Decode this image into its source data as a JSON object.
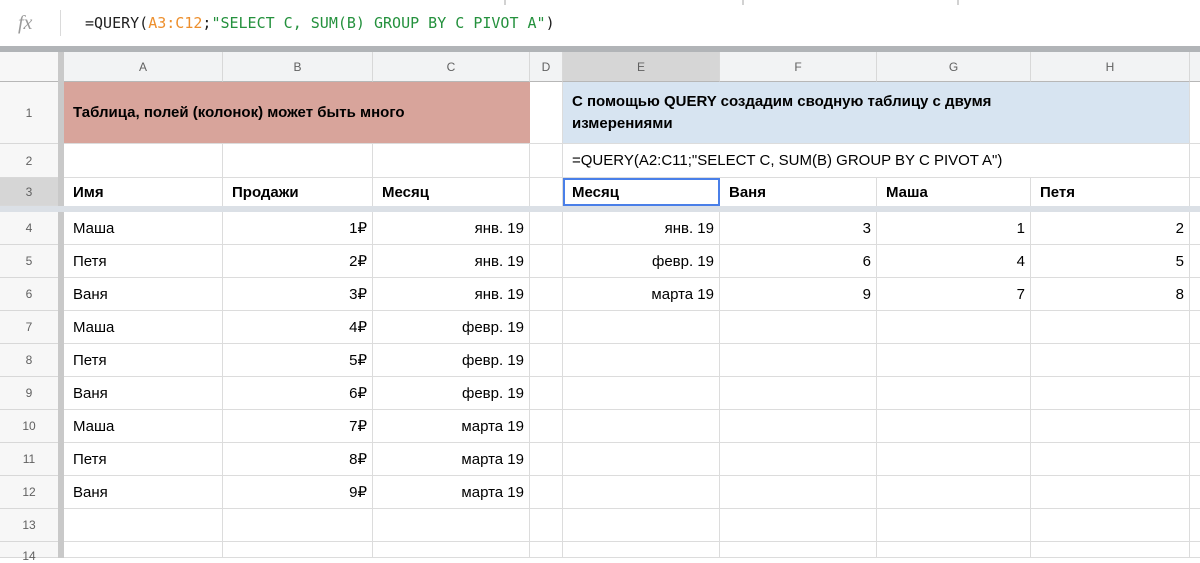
{
  "formula_bar": {
    "fx_label": "fx",
    "formula_parts": [
      {
        "text": "=QUERY(",
        "color": "#1f1f1f"
      },
      {
        "text": "A3:C12",
        "color": "#ed8f2d"
      },
      {
        "text": ";",
        "color": "#1f1f1f"
      },
      {
        "text": "\"SELECT C, SUM(B) GROUP BY C PIVOT A\"",
        "color": "#24913d"
      },
      {
        "text": ")",
        "color": "#1f1f1f"
      }
    ]
  },
  "columns": [
    "A",
    "B",
    "C",
    "D",
    "E",
    "F",
    "G",
    "H"
  ],
  "row_numbers": [
    "1",
    "2",
    "3",
    "4",
    "5",
    "6",
    "7",
    "8",
    "9",
    "10",
    "11",
    "12",
    "13",
    "14"
  ],
  "row1": {
    "left_banner": {
      "text": "Таблица, полей (колонок) может быть много",
      "bg": "#d8a49b"
    },
    "right_banner": {
      "text": "С помощью QUERY создадим сводную таблицу с двумя\nизмерениями",
      "bg": "#d7e4f1"
    }
  },
  "row2": {
    "formula_text": "=QUERY(A2:C11;\"SELECT C, SUM(B) GROUP BY C PIVOT A\")"
  },
  "left_table": {
    "headers": [
      "Имя",
      "Продажи",
      "Месяц"
    ],
    "rows": [
      [
        "Маша",
        "1₽",
        "янв. 19"
      ],
      [
        "Петя",
        "2₽",
        "янв. 19"
      ],
      [
        "Ваня",
        "3₽",
        "янв. 19"
      ],
      [
        "Маша",
        "4₽",
        "февр. 19"
      ],
      [
        "Петя",
        "5₽",
        "февр. 19"
      ],
      [
        "Ваня",
        "6₽",
        "февр. 19"
      ],
      [
        "Маша",
        "7₽",
        "марта 19"
      ],
      [
        "Петя",
        "8₽",
        "марта 19"
      ],
      [
        "Ваня",
        "9₽",
        "марта 19"
      ]
    ]
  },
  "pivot_table": {
    "headers": [
      "Месяц",
      "Ваня",
      "Маша",
      "Петя"
    ],
    "rows": [
      [
        "янв. 19",
        "3",
        "1",
        "2"
      ],
      [
        "февр. 19",
        "6",
        "4",
        "5"
      ],
      [
        "марта 19",
        "9",
        "7",
        "8"
      ]
    ]
  },
  "selection": {
    "cell": "E3",
    "column": "E",
    "row": "3",
    "border_color": "#4a7fe8"
  }
}
